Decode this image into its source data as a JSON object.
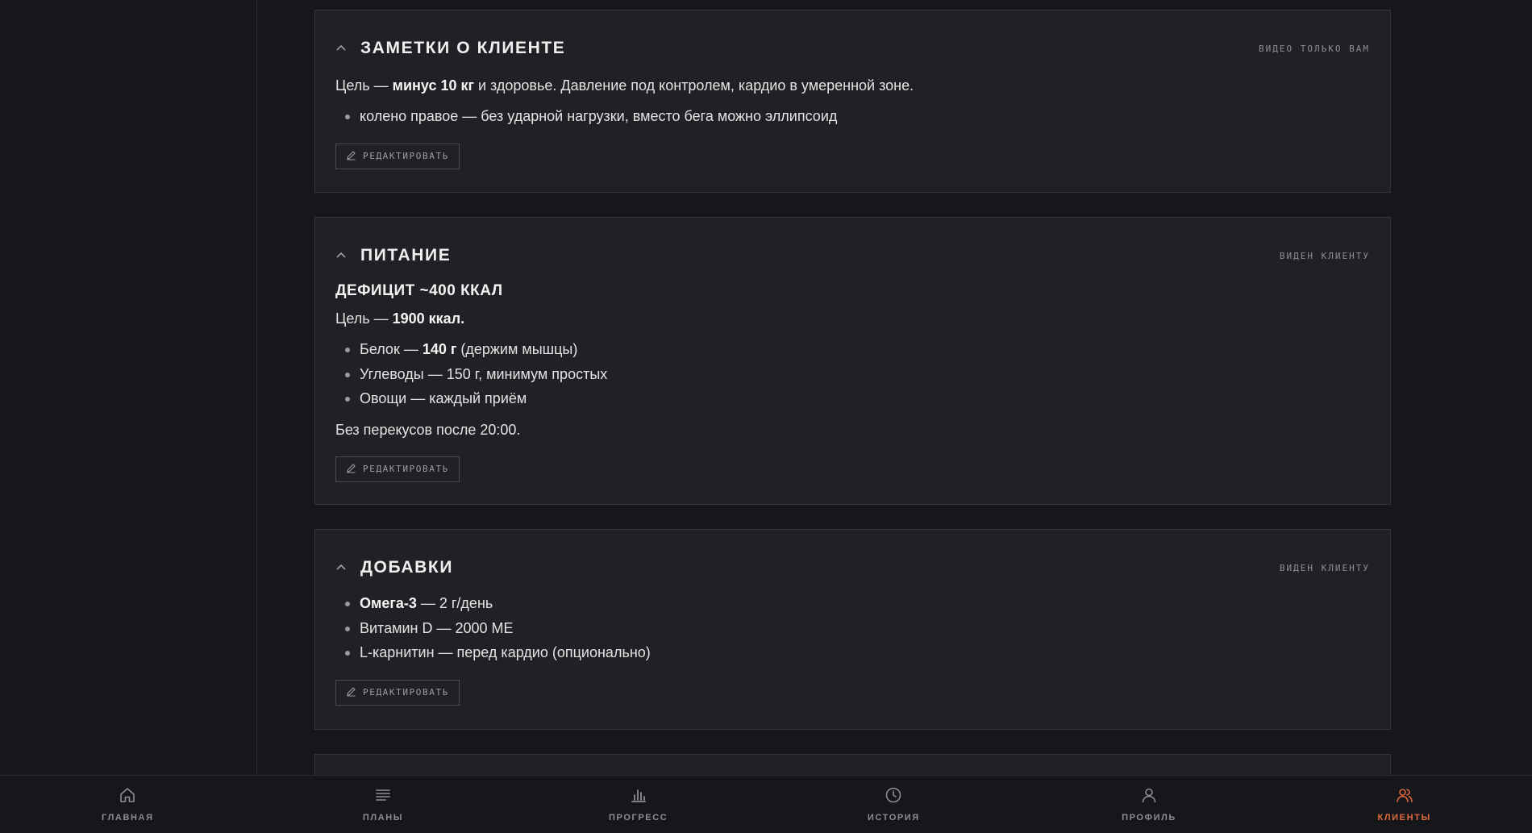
{
  "colors": {
    "background": "#16171b",
    "card": "#202125",
    "accent": "#e06a3f",
    "muted": "#8d8e93"
  },
  "cards": {
    "notes": {
      "title": "Заметки о клиенте",
      "visibility": "видео только вам",
      "intro_prefix": "Цель — ",
      "intro_bold": "минус 10 кг",
      "intro_suffix": " и здоровье. Давление под контролем, кардио в умеренной зоне.",
      "bullets": [
        "колено правое — без ударной нагрузки, вместо бега можно эллипсоид"
      ],
      "edit_label": "Редактировать"
    },
    "nutrition": {
      "title": "Питание",
      "visibility": "виден клиенту",
      "subheading": "ДЕФИЦИТ ~400 ККАЛ",
      "goal_prefix": "Цель — ",
      "goal_bold": "1900 ккал.",
      "bullets": [
        {
          "prefix": "Белок — ",
          "bold": "140 г",
          "suffix": " (держим мышцы)"
        },
        {
          "prefix": "Углеводы — 150 г, минимум простых",
          "bold": "",
          "suffix": ""
        },
        {
          "prefix": "Овощи — каждый приём",
          "bold": "",
          "suffix": ""
        }
      ],
      "note": "Без перекусов после 20:00.",
      "edit_label": "Редактировать"
    },
    "supplements": {
      "title": "Добавки",
      "visibility": "виден клиенту",
      "bullets": [
        {
          "bold": "Омега-3",
          "suffix": " — 2 г/день"
        },
        {
          "bold": "",
          "suffix": "Витамин D — 2000 МЕ"
        },
        {
          "bold": "",
          "suffix": "L-карнитин — перед кардио (опционально)"
        }
      ],
      "edit_label": "Редактировать"
    }
  },
  "bottom_nav": {
    "items": [
      {
        "label": "Главная",
        "icon": "home-icon"
      },
      {
        "label": "Планы",
        "icon": "list-icon"
      },
      {
        "label": "Прогресс",
        "icon": "bar-chart-icon"
      },
      {
        "label": "История",
        "icon": "clock-icon"
      },
      {
        "label": "Профиль",
        "icon": "user-icon"
      },
      {
        "label": "Клиенты",
        "icon": "users-icon",
        "active": true
      }
    ]
  }
}
